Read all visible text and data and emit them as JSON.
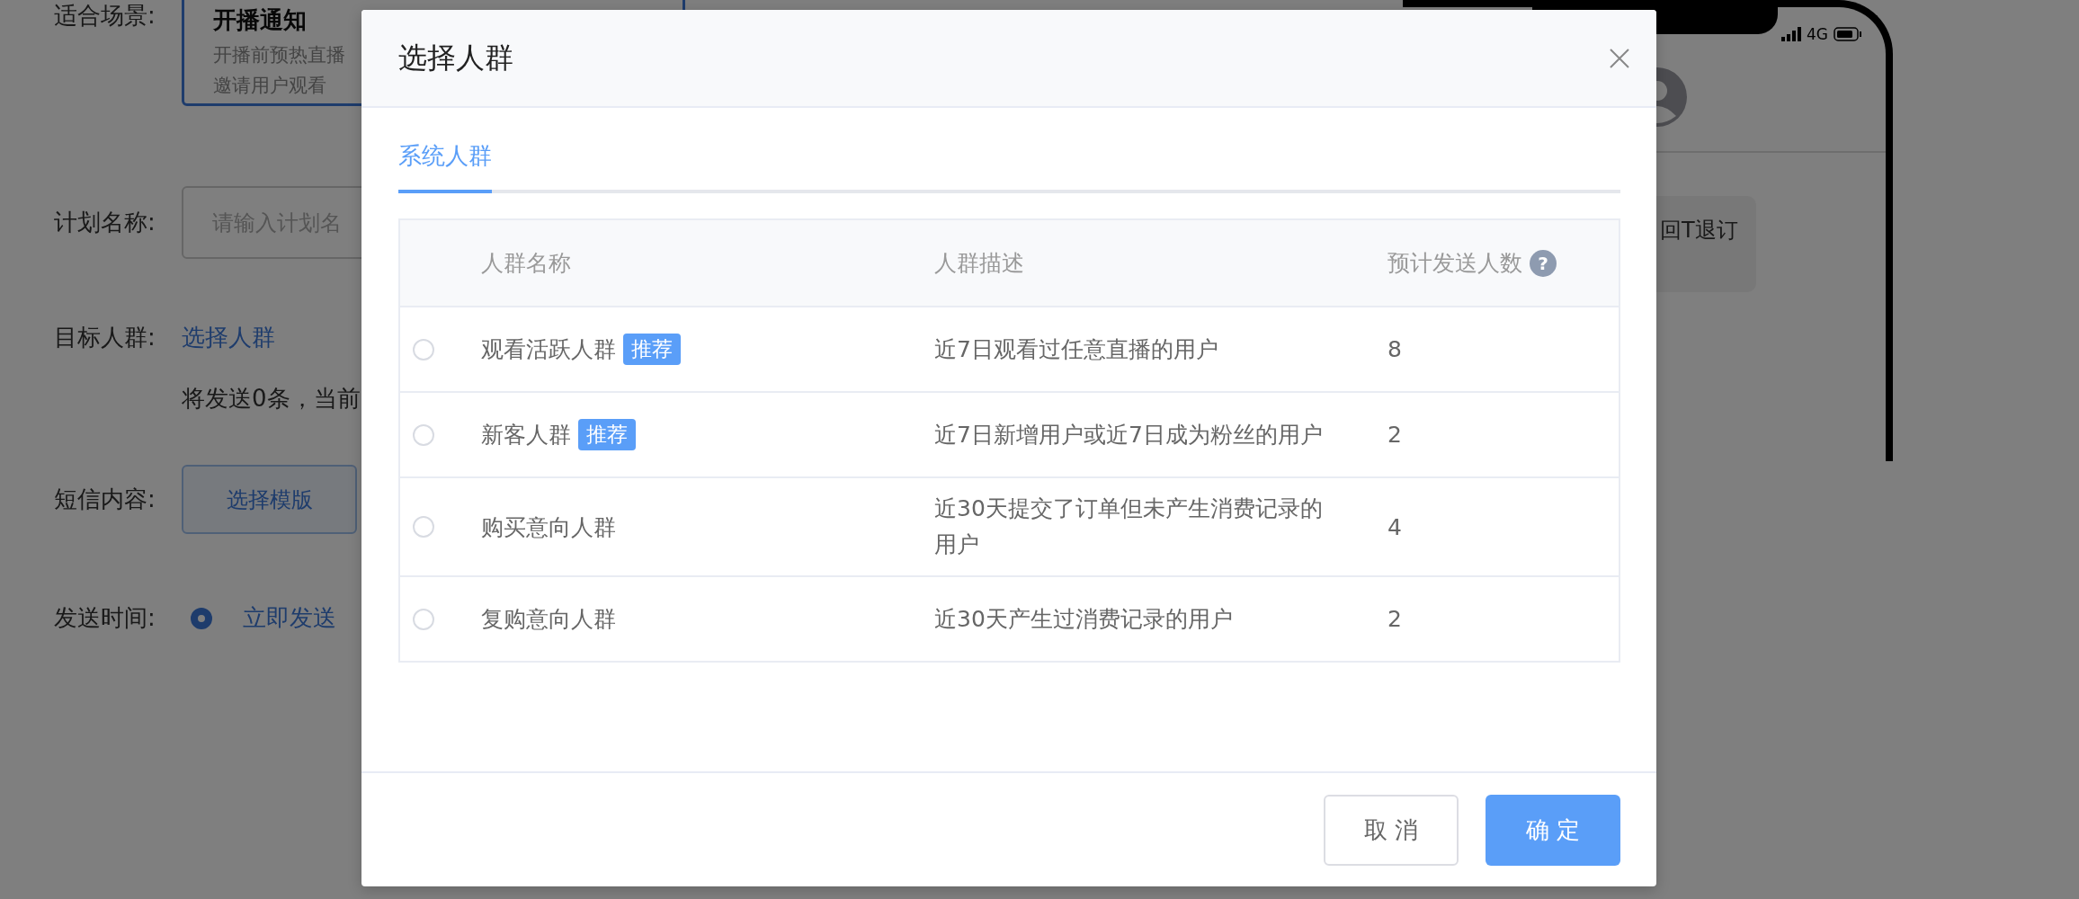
{
  "form": {
    "scene": {
      "label": "适合场景:",
      "cards": [
        {
          "title": "开播通知",
          "description": [
            "开播前预热直播",
            "邀请用户观看"
          ],
          "selected": true
        }
      ]
    },
    "plan_name": {
      "label": "计划名称:",
      "placeholder": "请输入计划名"
    },
    "target": {
      "label": "目标人群:",
      "link": "选择人群",
      "summary": "将发送0条，当前"
    },
    "sms_content": {
      "label": "短信内容:",
      "button": "选择模版"
    },
    "send_time": {
      "label": "发送时间:",
      "options": [
        {
          "label": "立即发送",
          "selected": true
        }
      ]
    }
  },
  "phone_preview": {
    "network": "4G",
    "message": "回T退订"
  },
  "dialog": {
    "title": "选择人群",
    "tabs": [
      {
        "label": "系统人群",
        "selected": true
      }
    ],
    "table": {
      "columns": [
        "人群名称",
        "人群描述",
        "预计发送人数"
      ],
      "help_icon": "?",
      "rows": [
        {
          "name": "观看活跃人群",
          "badge": "推荐",
          "description": "近7日观看过任意直播的用户",
          "count": "8",
          "selected": false
        },
        {
          "name": "新客人群",
          "badge": "推荐",
          "description": "近7日新增用户或近7日成为粉丝的用户",
          "count": "2",
          "selected": false
        },
        {
          "name": "购买意向人群",
          "description": "近30天提交了订单但未产生消费记录的用户",
          "count": "4",
          "selected": false
        },
        {
          "name": "复购意向人群",
          "description": "近30天产生过消费记录的用户",
          "count": "2",
          "selected": false
        }
      ]
    },
    "buttons": [
      {
        "label": "取消",
        "kind": "secondary"
      },
      {
        "label": "确定",
        "kind": "primary"
      }
    ]
  }
}
